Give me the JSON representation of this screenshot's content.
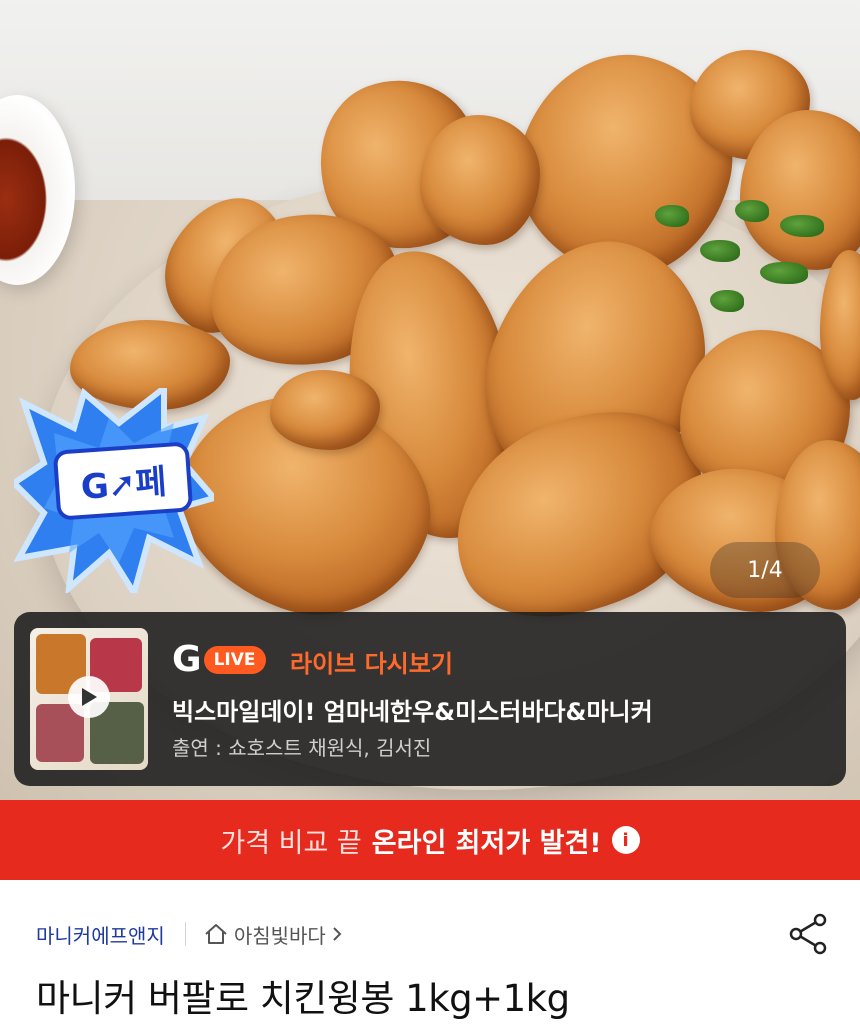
{
  "hero": {
    "badge": "G➚페",
    "counter": "1/4"
  },
  "live": {
    "brand_letter": "G",
    "brand_pill": "LIVE",
    "replay_label": "라이브 다시보기",
    "title": "빅스마일데이! 엄마네한우&미스터바다&마니커",
    "cast": "출연 : 쇼호스트 채원식, 김서진"
  },
  "banner": {
    "text_normal": "가격 비교 끝",
    "text_bold": "온라인 최저가 발견!",
    "icon": "i"
  },
  "product": {
    "seller": "마니커에프앤지",
    "store": "아침빛바다",
    "title": "마니커 버팔로 치킨윙봉 1kg+1kg"
  },
  "colors": {
    "banner": "#e62a1e",
    "live_accent": "#ff6a2b",
    "seller_link": "#1f3a9e"
  },
  "icons": [
    "home-icon",
    "chevron-right-icon",
    "share-icon",
    "play-icon",
    "info-icon"
  ]
}
